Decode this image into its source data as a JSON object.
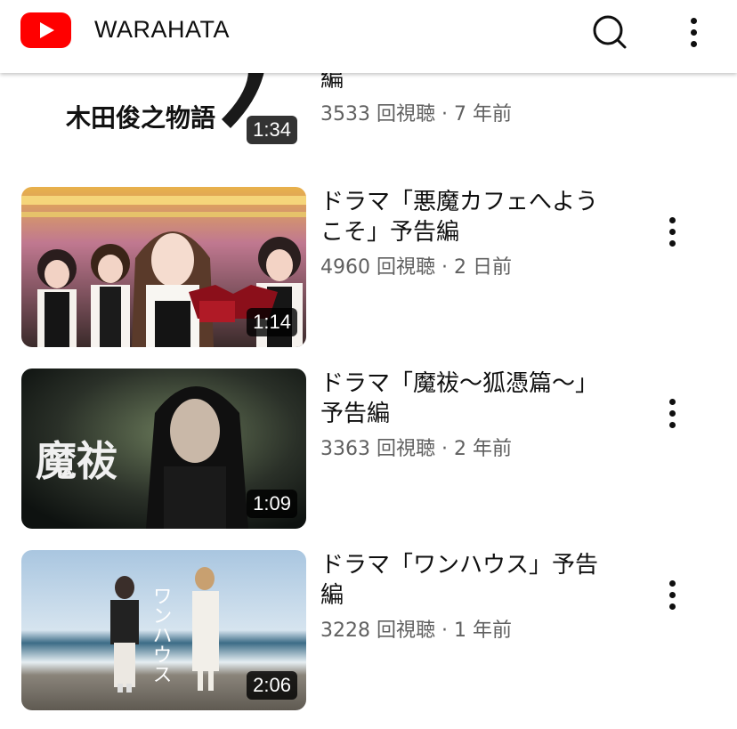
{
  "header": {
    "channel": "WARAHATA",
    "logo_icon": "youtube-logo-icon",
    "search_icon": "search-icon",
    "menu_icon": "more-vert-icon"
  },
  "videos": [
    {
      "title": "編",
      "views": "3533 回視聴",
      "sep": "·",
      "age": "7 年前",
      "duration": "1:34",
      "thumb_text": "木田俊之物語"
    },
    {
      "title": "ドラマ「悪魔カフェへようこそ」予告編",
      "views": "4960 回視聴",
      "sep": "·",
      "age": "2 日前",
      "duration": "1:14"
    },
    {
      "title": "ドラマ「魔祓～狐憑篇～」予告編",
      "views": "3363 回視聴",
      "sep": "·",
      "age": "2 年前",
      "duration": "1:09",
      "thumb_text": "魔祓"
    },
    {
      "title": "ドラマ「ワンハウス」予告編",
      "views": "3228 回視聴",
      "sep": "·",
      "age": "1 年前",
      "duration": "2:06",
      "thumb_text": "ワンハウス"
    }
  ],
  "colors": {
    "brand_red": "#ff0000",
    "text_primary": "#0f0f0f",
    "text_secondary": "#606060"
  }
}
